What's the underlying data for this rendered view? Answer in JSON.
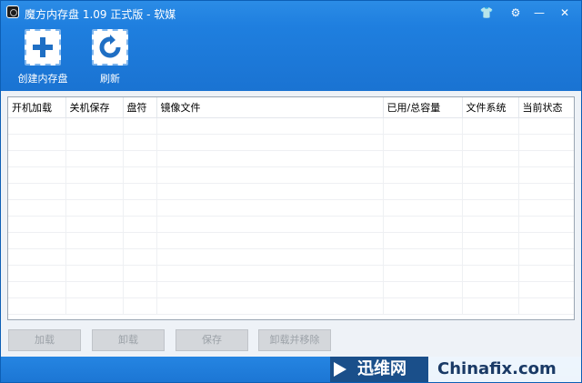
{
  "window": {
    "title": "魔方内存盘 1.09 正式版 - 软媒",
    "controls": {
      "skin": "👕",
      "settings": "⚙",
      "minimize": "—",
      "close": "✕"
    }
  },
  "toolbar": {
    "create_label": "创建内存盘",
    "refresh_label": "刷新"
  },
  "table": {
    "columns": [
      "开机加载",
      "关机保存",
      "盘符",
      "镜像文件",
      "已用/总容量",
      "文件系统",
      "当前状态"
    ]
  },
  "buttons": {
    "load": "加载",
    "unload": "卸载",
    "save": "保存",
    "unload_remove": "卸载并移除"
  },
  "watermark": {
    "brand": "迅维网",
    "site": "Chinafix.com"
  },
  "colors": {
    "title_bar": "#2b8ce6",
    "toolbar": "#1f7fdf",
    "disabled_button": "#d4d7db"
  }
}
